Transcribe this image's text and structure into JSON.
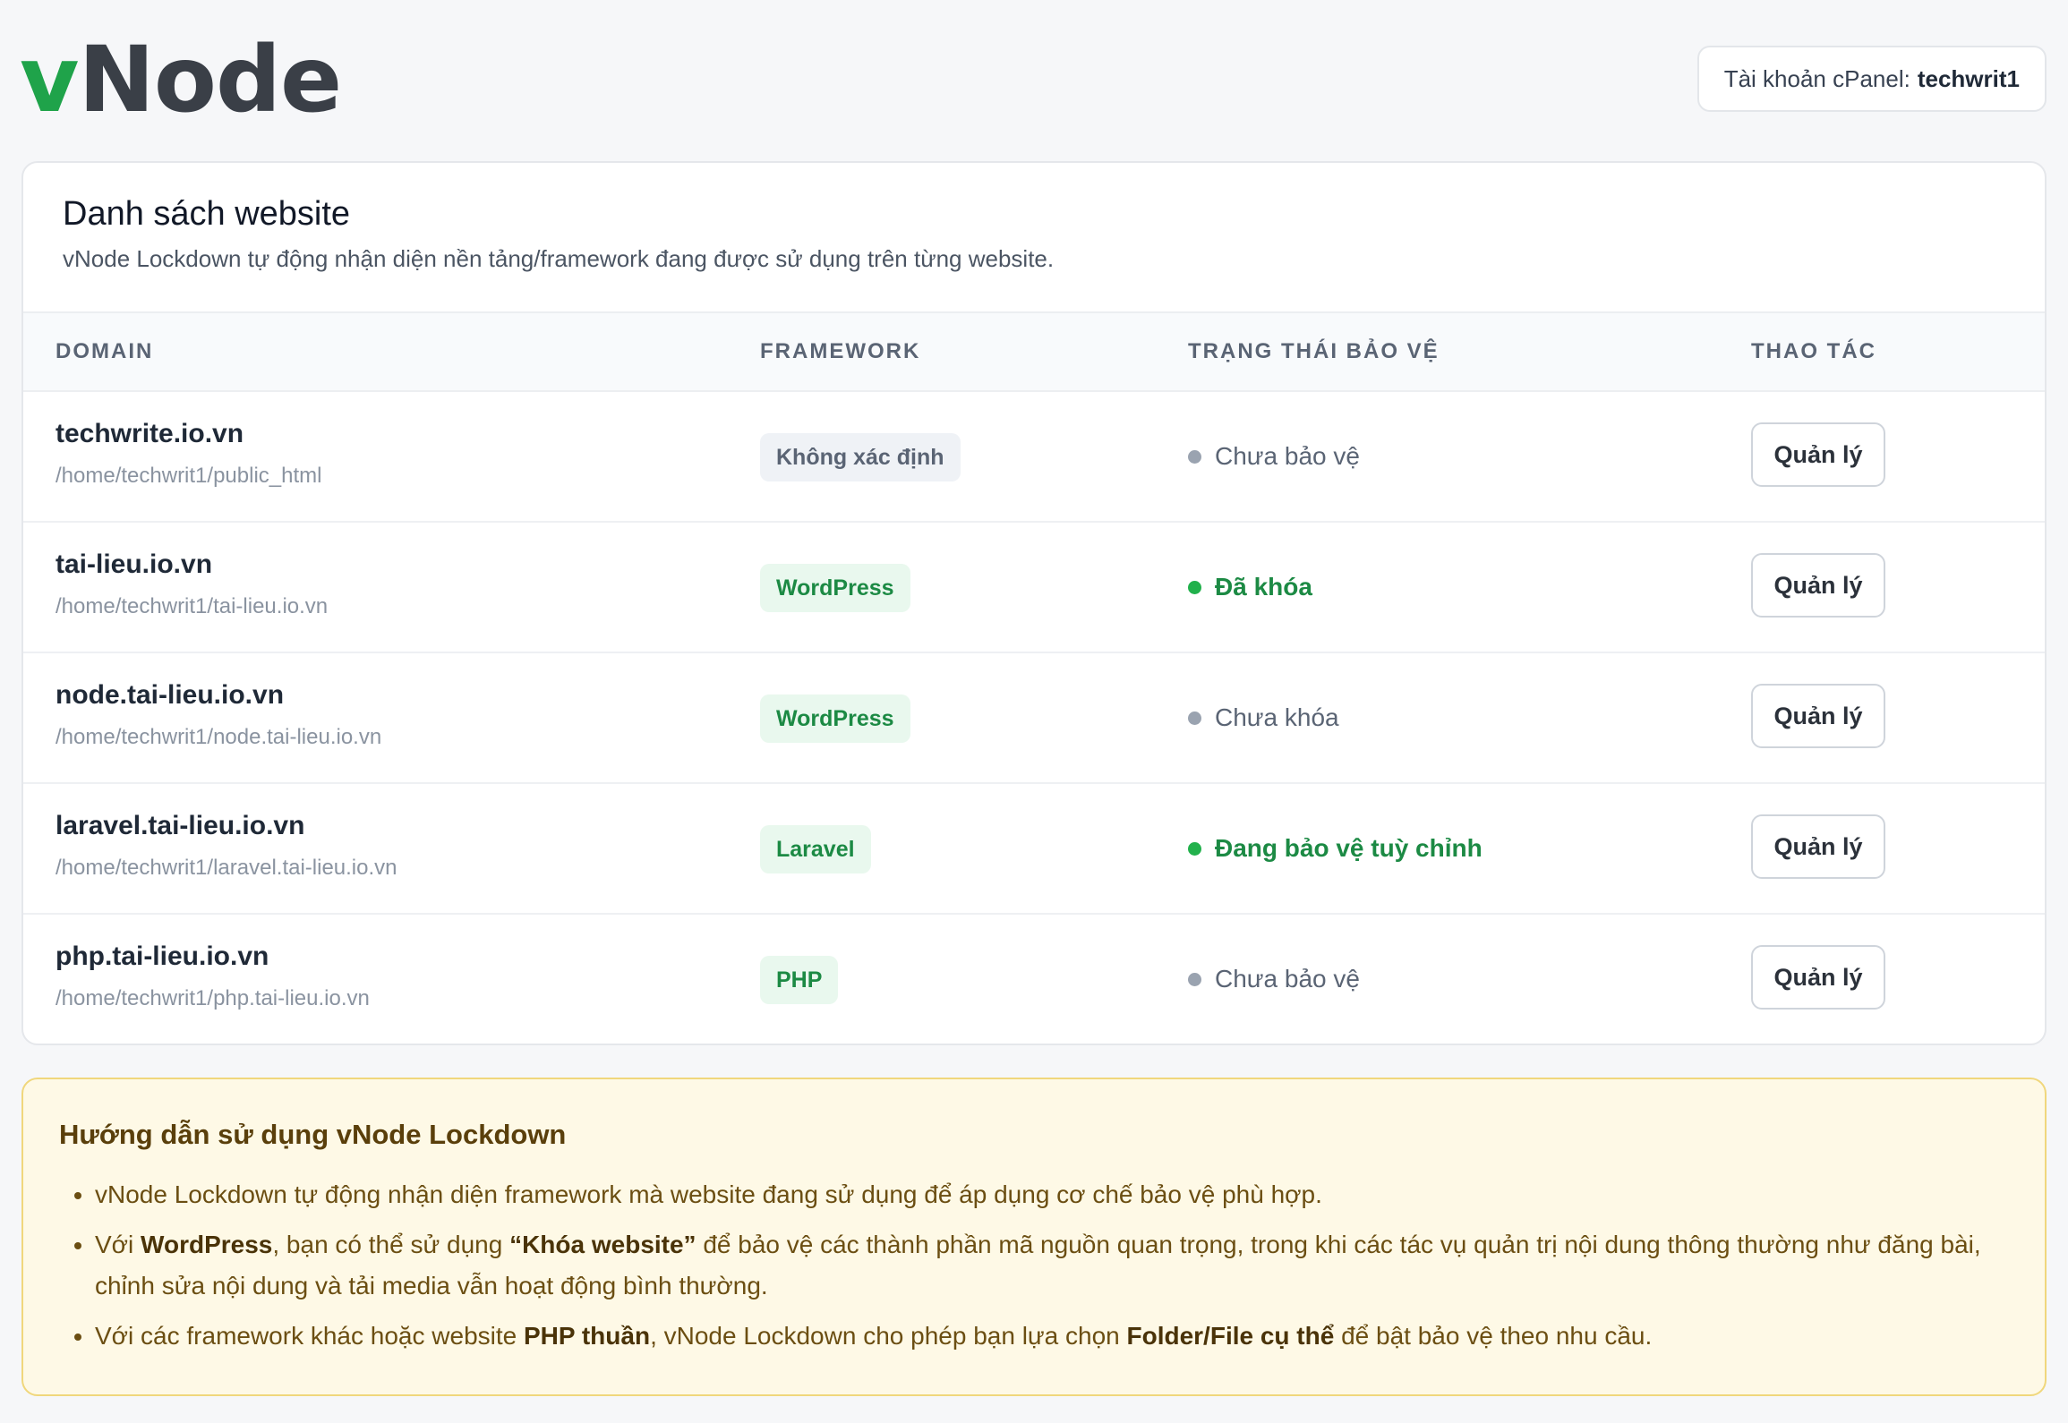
{
  "brand": {
    "prefix": "v",
    "name": "Node",
    "accent_color": "#1fa34a"
  },
  "account": {
    "label": "Tài khoản cPanel:",
    "username": "techwrit1"
  },
  "list": {
    "title": "Danh sách website",
    "subtitle": "vNode Lockdown tự động nhận diện nền tảng/framework đang được sử dụng trên từng website.",
    "columns": [
      "DOMAIN",
      "FRAMEWORK",
      "TRẠNG THÁI BẢO VỆ",
      "THAO TÁC"
    ],
    "rows": [
      {
        "domain": "techwrite.io.vn",
        "path": "/home/techwrit1/public_html",
        "framework": "Không xác định",
        "framework_style": "gray",
        "status": "Chưa bảo vệ",
        "status_style": "gray",
        "action": "Quản lý"
      },
      {
        "domain": "tai-lieu.io.vn",
        "path": "/home/techwrit1/tai-lieu.io.vn",
        "framework": "WordPress",
        "framework_style": "green",
        "status": "Đã khóa",
        "status_style": "green",
        "action": "Quản lý"
      },
      {
        "domain": "node.tai-lieu.io.vn",
        "path": "/home/techwrit1/node.tai-lieu.io.vn",
        "framework": "WordPress",
        "framework_style": "green",
        "status": "Chưa khóa",
        "status_style": "gray",
        "action": "Quản lý"
      },
      {
        "domain": "laravel.tai-lieu.io.vn",
        "path": "/home/techwrit1/laravel.tai-lieu.io.vn",
        "framework": "Laravel",
        "framework_style": "green",
        "status": "Đang bảo vệ tuỳ chỉnh",
        "status_style": "green",
        "action": "Quản lý"
      },
      {
        "domain": "php.tai-lieu.io.vn",
        "path": "/home/techwrit1/php.tai-lieu.io.vn",
        "framework": "PHP",
        "framework_style": "green",
        "status": "Chưa bảo vệ",
        "status_style": "gray",
        "action": "Quản lý"
      }
    ]
  },
  "guide": {
    "title": "Hướng dẫn sử dụng vNode Lockdown",
    "item1": "vNode Lockdown tự động nhận diện framework mà website đang sử dụng để áp dụng cơ chế bảo vệ phù hợp.",
    "item2": {
      "p1": "Với ",
      "b1": "WordPress",
      "p2": ", bạn có thể sử dụng ",
      "b2": "“Khóa website”",
      "p3": " để bảo vệ các thành phần mã nguồn quan trọng, trong khi các tác vụ quản trị nội dung thông thường như đăng bài, chỉnh sửa nội dung và tải media vẫn hoạt động bình thường."
    },
    "item3": {
      "p1": "Với các framework khác hoặc website ",
      "b1": "PHP thuần",
      "p2": ", vNode Lockdown cho phép bạn lựa chọn ",
      "b2": "Folder/File cụ thể",
      "p3": " để bật bảo vệ theo nhu cầu."
    }
  }
}
